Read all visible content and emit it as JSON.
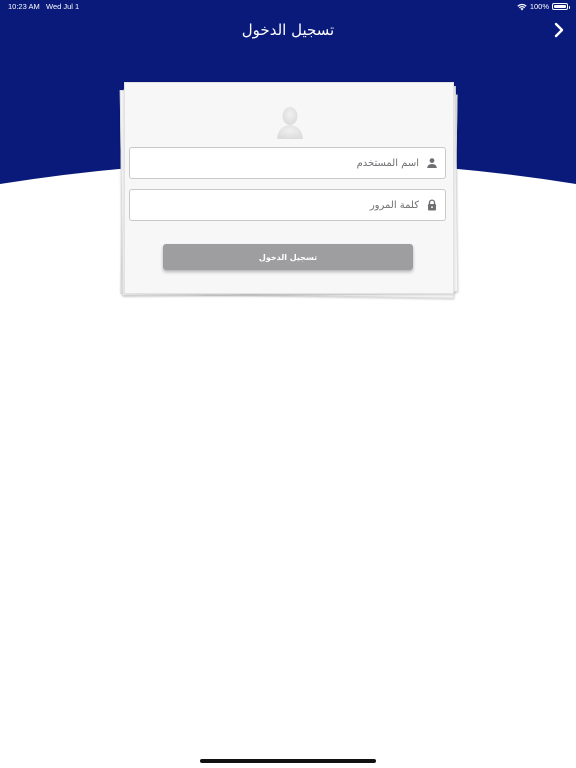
{
  "status_bar": {
    "time": "10:23 AM",
    "date": "Wed Jul 1",
    "battery": "100%",
    "battery_level": 1.0
  },
  "nav": {
    "title": "تسجيل الدخول",
    "back_icon": "chevron-right-icon"
  },
  "login_form": {
    "avatar_icon": "user-silhouette-icon",
    "username": {
      "placeholder": "اسم المستخدم",
      "value": "",
      "icon": "person-icon"
    },
    "password": {
      "placeholder": "كلمة المرور",
      "value": "",
      "icon": "lock-icon"
    },
    "submit_label": "تسجيل الدخول"
  },
  "colors": {
    "header": "#0a1a7a",
    "button": "#9e9ea1",
    "card": "#f7f7f8",
    "icon": "#6f6f73"
  }
}
